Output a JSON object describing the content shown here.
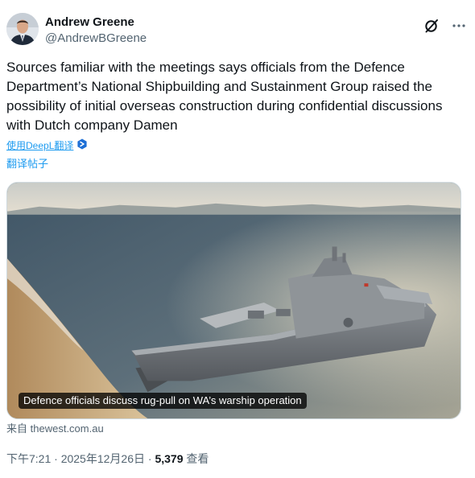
{
  "author": {
    "display_name": "Andrew Greene",
    "handle": "@AndrewBGreene"
  },
  "header_icons": [
    "grok-slash-icon",
    "more-options-icon"
  ],
  "tweet": {
    "text": "Sources familiar with the meetings says officials from the Defence Department’s National Shipbuilding and Sustainment Group raised the possibility of initial overseas construction during confidential discussions with Dutch company Damen"
  },
  "translation": {
    "powered_by": "使用DeepL翻译",
    "translate_post": "翻译帖子"
  },
  "card": {
    "caption": "Defence officials discuss rug-pull on WA’s warship operation",
    "source_prefix": "来自",
    "source_domain": "thewest.com.au"
  },
  "meta": {
    "time": "下午7:21",
    "separator": "·",
    "date": "2025年12月26日",
    "views_count": "5,379",
    "views_label": "查看"
  },
  "colors": {
    "link_blue": "#1d9bf0",
    "secondary_text": "#536471",
    "primary_text": "#0f1419"
  }
}
